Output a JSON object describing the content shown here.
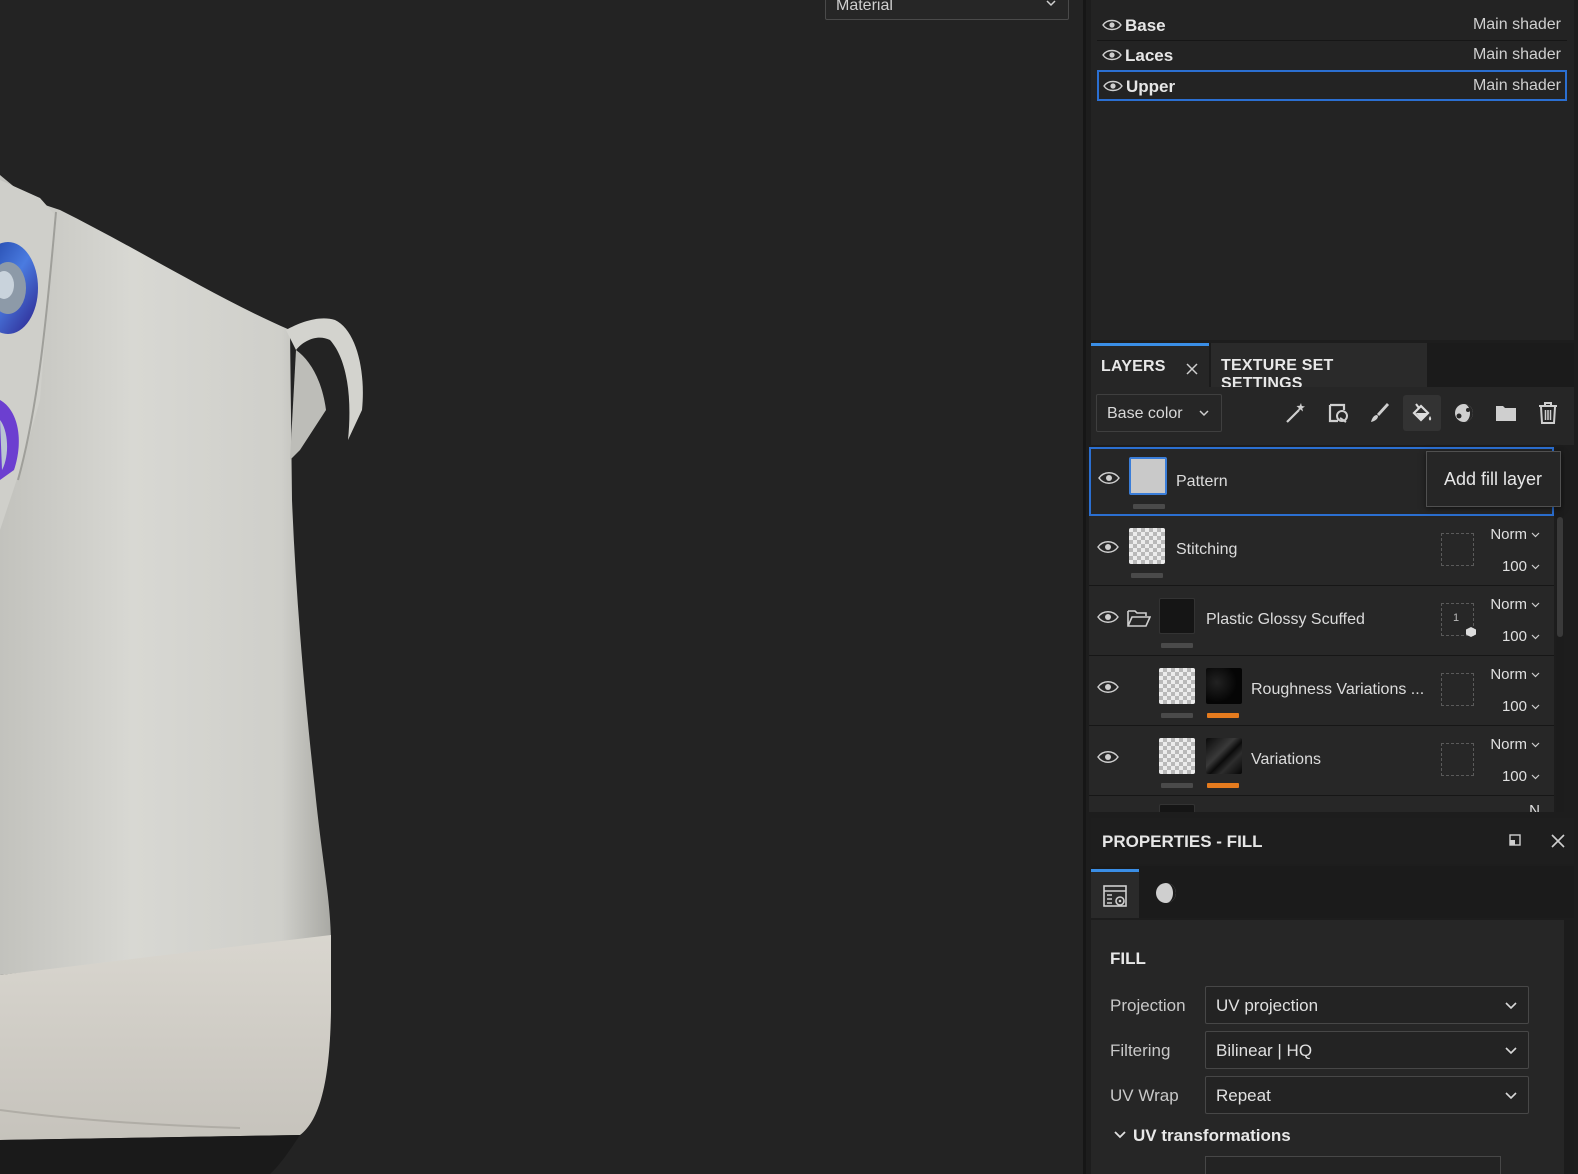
{
  "viewport": {
    "mode_select": "Material"
  },
  "texture_sets": [
    {
      "name": "Base",
      "shader": "Main shader",
      "selected": false
    },
    {
      "name": "Laces",
      "shader": "Main shader",
      "selected": false
    },
    {
      "name": "Upper",
      "shader": "Main shader",
      "selected": true
    }
  ],
  "tabs": {
    "layers": "LAYERS",
    "texture_set_settings": "TEXTURE SET SETTINGS"
  },
  "toolbar": {
    "channel": "Base color",
    "tools": [
      "magic-wand-icon",
      "smart-material-icon",
      "paint-brush-icon",
      "fill-bucket-icon",
      "mask-icon",
      "folder-icon",
      "trash-icon"
    ],
    "tooltip": "Add fill layer"
  },
  "layers": [
    {
      "name": "Pattern",
      "blend": "",
      "opacity": "",
      "selected": true
    },
    {
      "name": "Stitching",
      "blend": "Norm",
      "opacity": "100",
      "selected": false
    },
    {
      "name": "Plastic Glossy Scuffed",
      "blend": "Norm",
      "opacity": "100",
      "mask_count": "1",
      "selected": false
    },
    {
      "name": "Roughness Variations ...",
      "blend": "Norm",
      "opacity": "100",
      "selected": false
    },
    {
      "name": "Variations",
      "blend": "Norm",
      "opacity": "100",
      "selected": false
    },
    {
      "name": "",
      "blend": "N",
      "opacity": "",
      "selected": false
    }
  ],
  "properties": {
    "title": "PROPERTIES - FILL",
    "section": "FILL",
    "projection_label": "Projection",
    "projection_value": "UV projection",
    "filtering_label": "Filtering",
    "filtering_value": "Bilinear | HQ",
    "uvwrap_label": "UV Wrap",
    "uvwrap_value": "Repeat",
    "uv_transformations": "UV transformations"
  },
  "colors": {
    "accent_blue": "#2b6fd1",
    "mask_orange": "#e57b1e",
    "panel_bg": "#1d1d1d"
  }
}
